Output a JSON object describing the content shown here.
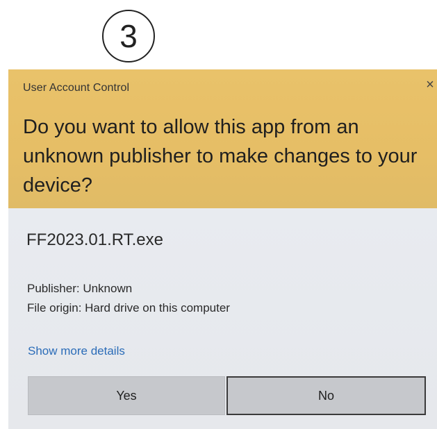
{
  "step": {
    "number": "3"
  },
  "dialog": {
    "title": "User Account Control",
    "close_glyph": "×",
    "question": "Do you want to allow this app from an unknown publisher to make changes to your device?",
    "file_name": "FF2023.01.RT.exe",
    "publisher": "Publisher: Unknown",
    "file_origin": "File origin: Hard drive on this computer",
    "details_link": "Show more details",
    "yes_label": "Yes",
    "no_label": "No"
  },
  "colors": {
    "header": "#e9c26a",
    "body": "#e8eaee",
    "link": "#2b6cb8",
    "button": "#c6c8cc"
  }
}
